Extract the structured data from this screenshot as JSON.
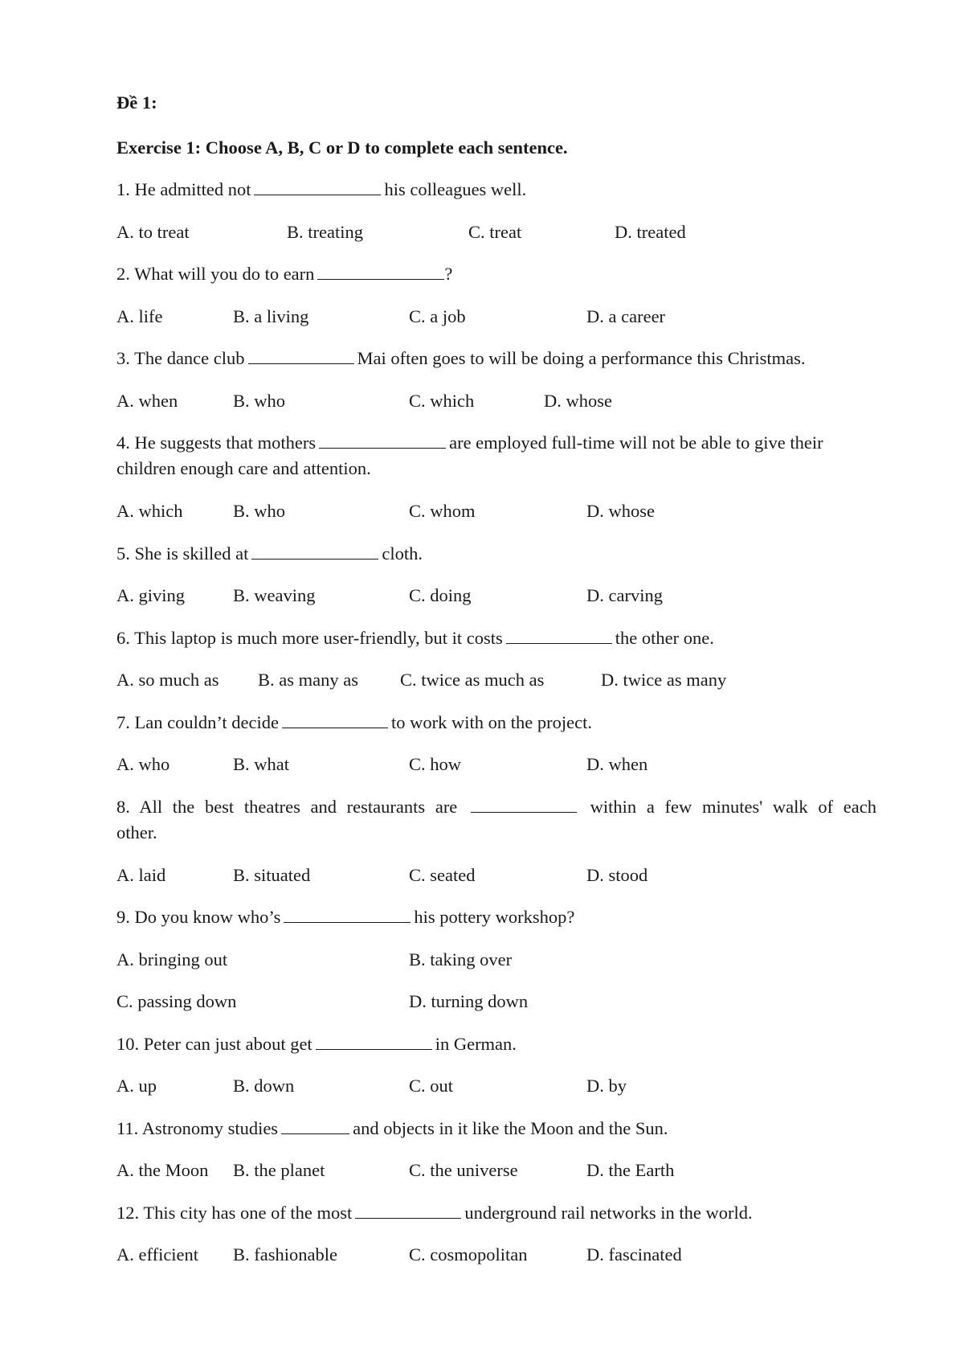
{
  "document": {
    "title": "Đề 1:",
    "exercise_heading": "Exercise 1: Choose A, B, C or D to complete each sentence.",
    "questions": [
      {
        "number": "1.",
        "before": "He admitted not",
        "after": "his colleagues well.",
        "options": [
          "A. to treat",
          "B. treating",
          "C. treat",
          "D. treated"
        ]
      },
      {
        "number": "2.",
        "before": "What will you do to earn",
        "after": "?",
        "options": [
          "A. life",
          "B. a living",
          "C. a job",
          "D. a career"
        ]
      },
      {
        "number": "3.",
        "before": "The dance club",
        "after": "Mai often goes to will be doing a performance this Christmas.",
        "options": [
          "A. when",
          "B. who",
          "C. which",
          "D. whose"
        ]
      },
      {
        "number": "4.",
        "before": "He suggests that mothers",
        "after": "are employed full-time will not be able to give their",
        "continuation": "children enough care and attention.",
        "options": [
          "A. which",
          "B. who",
          "C. whom",
          "D. whose"
        ]
      },
      {
        "number": "5.",
        "before": "She is skilled at",
        "after": "cloth.",
        "options": [
          "A. giving",
          "B. weaving",
          "C. doing",
          "D. carving"
        ]
      },
      {
        "number": "6.",
        "before": "This laptop is much more user-friendly, but it costs",
        "after": "the other one.",
        "options": [
          "A. so much as",
          "B. as many as",
          "C. twice as much as",
          "D. twice as many"
        ]
      },
      {
        "number": "7.",
        "before": "Lan couldn’t decide",
        "after": "to work with on the project.",
        "options": [
          "A. who",
          "B. what",
          "C. how",
          "D. when"
        ]
      },
      {
        "number": "8.",
        "before": "All the best theatres and restaurants are",
        "after": "within a few minutes' walk of each",
        "continuation": "other.",
        "options": [
          "A. laid",
          "B. situated",
          "C. seated",
          "D. stood"
        ]
      },
      {
        "number": "9.",
        "before": "Do you know who’s",
        "after": "his pottery workshop?",
        "options": [
          "A. bringing out",
          "B. taking over",
          "C. passing down",
          "D. turning down"
        ]
      },
      {
        "number": "10.",
        "before": "Peter can just about get",
        "after": "in German.",
        "options": [
          "A. up",
          "B. down",
          "C. out",
          "D. by"
        ]
      },
      {
        "number": "11.",
        "before": "Astronomy studies",
        "after": "and objects in it like the Moon and the Sun.",
        "options": [
          "A. the Moon",
          "B. the planet",
          "C. the universe",
          "D. the Earth"
        ]
      },
      {
        "number": "12.",
        "before": "This city has one of the most",
        "after": "underground rail networks in the world.",
        "options": [
          "A. efficient",
          "B. fashionable",
          "C. cosmopolitan",
          "D. fascinated"
        ]
      }
    ]
  }
}
